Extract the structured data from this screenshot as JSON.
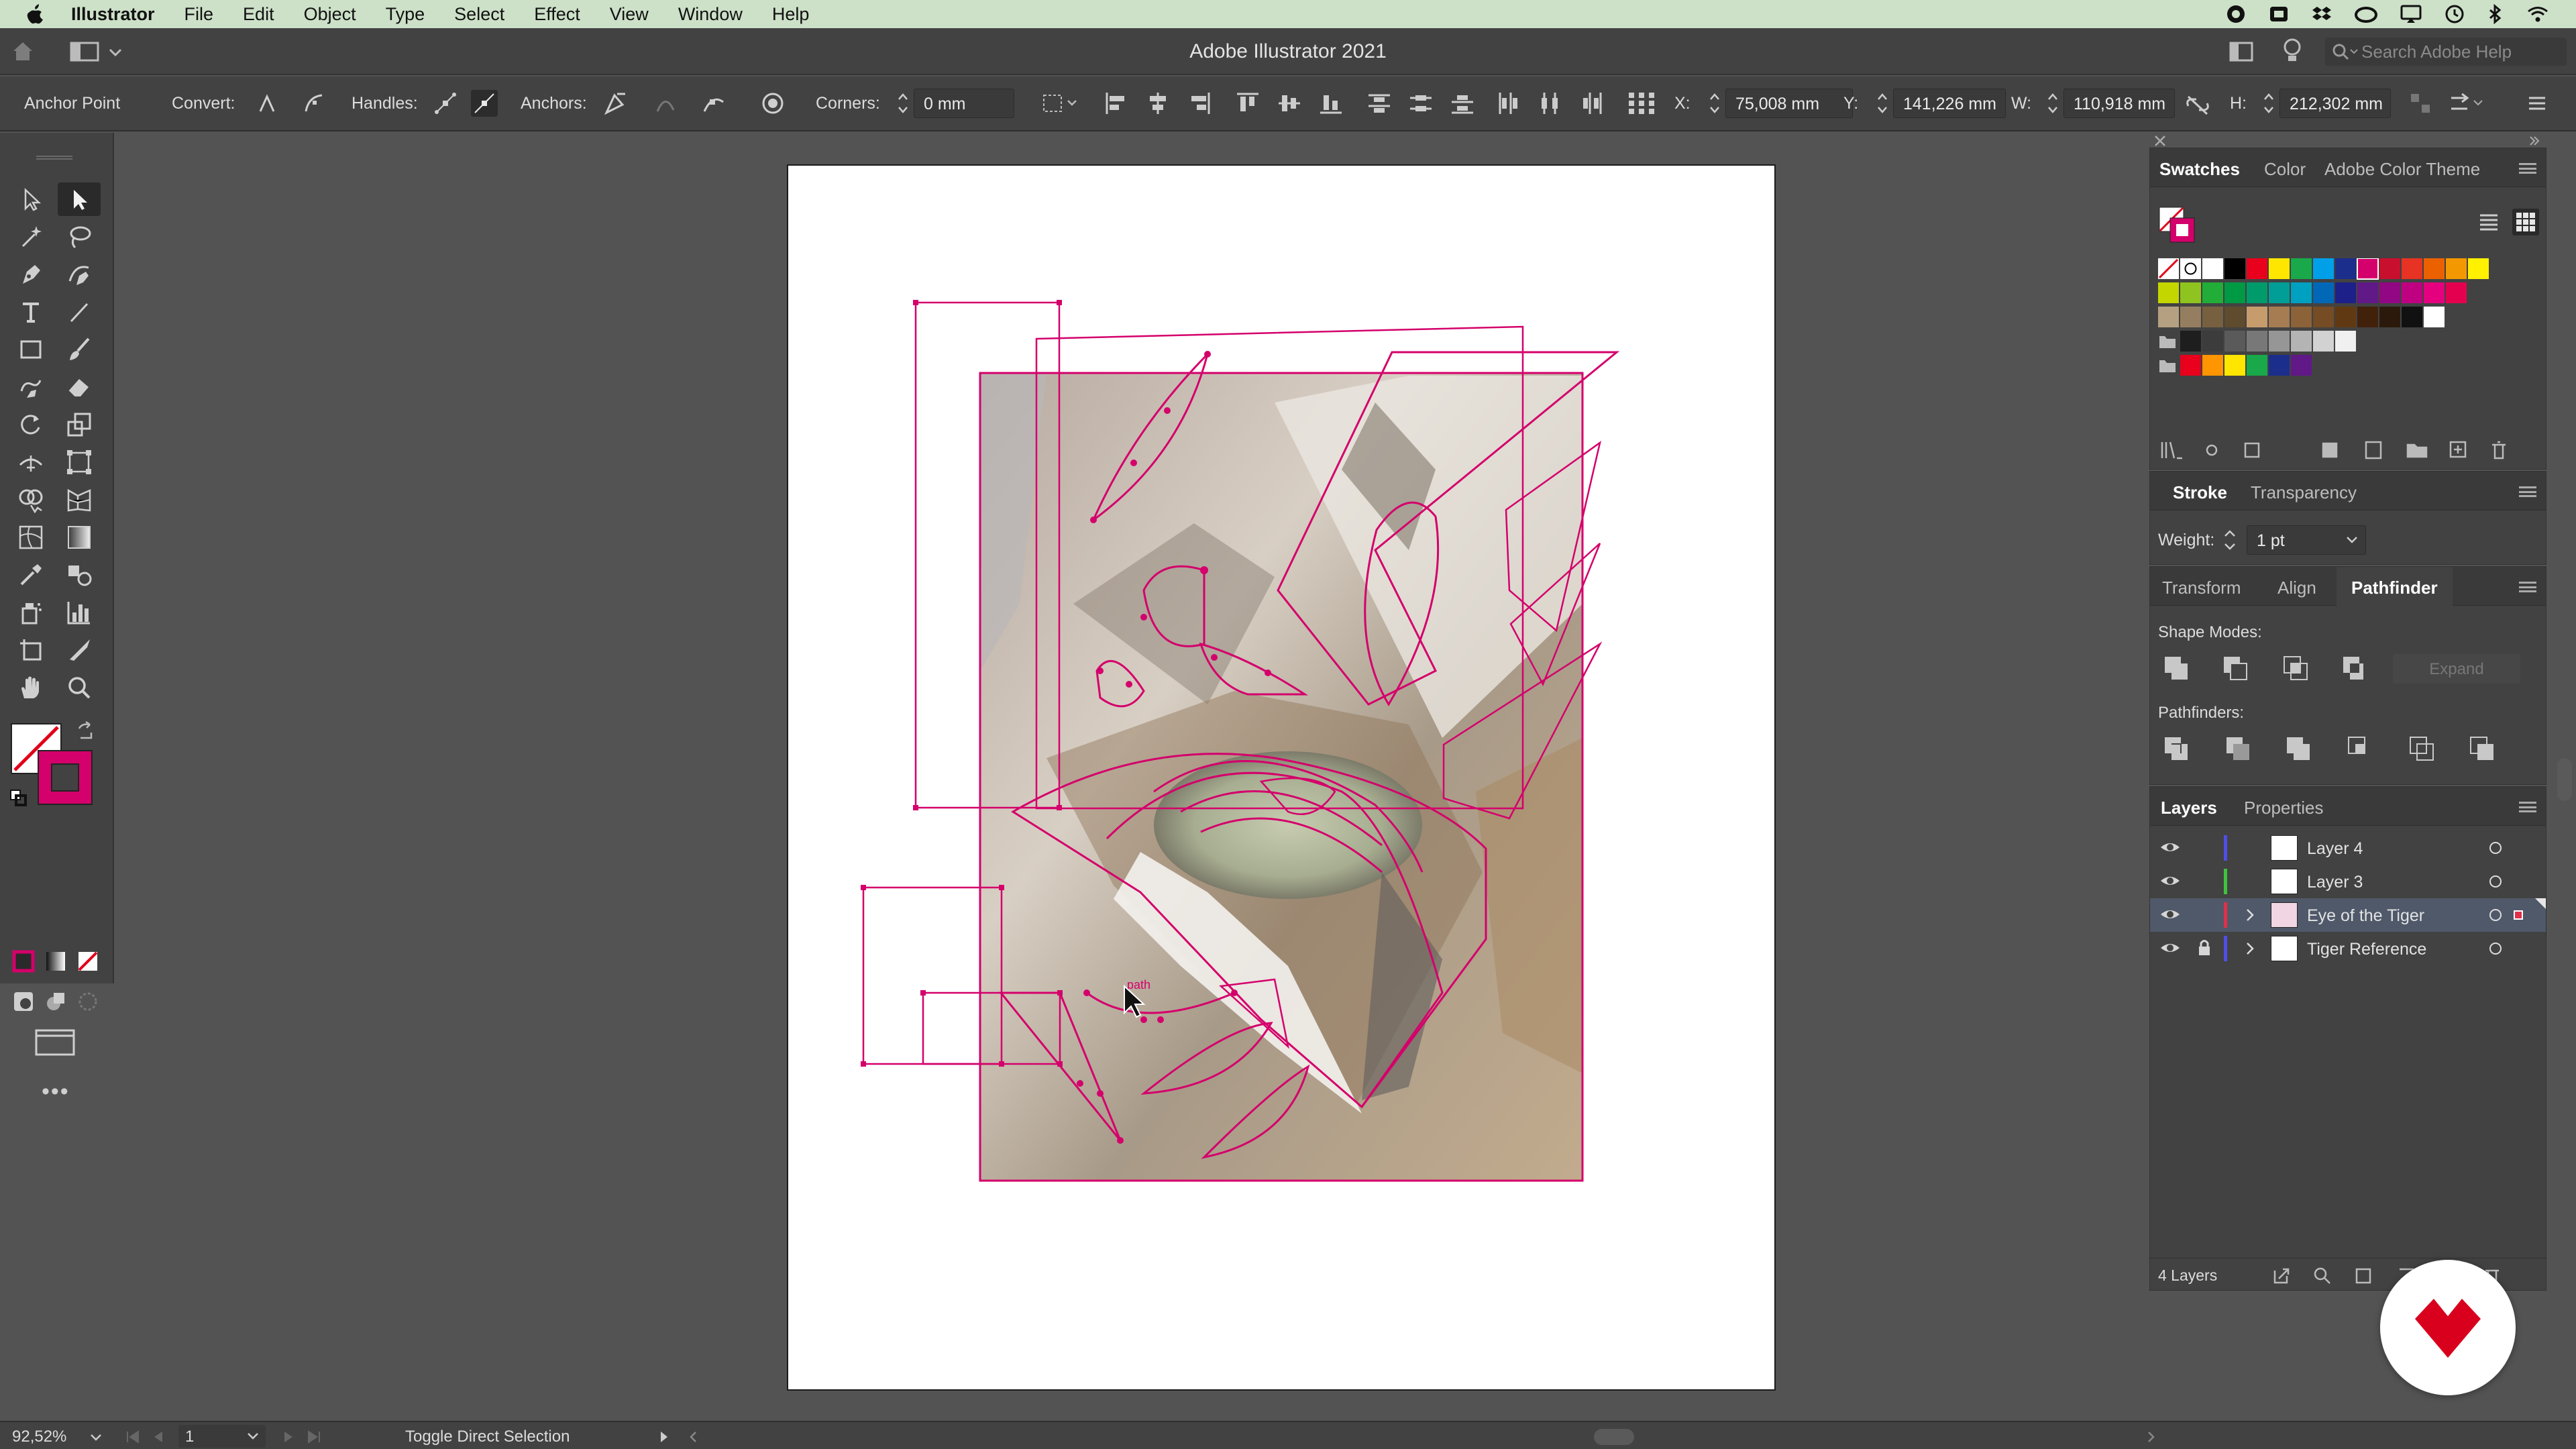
{
  "menubar": {
    "app_name": "Illustrator",
    "items": [
      "File",
      "Edit",
      "Object",
      "Type",
      "Select",
      "Effect",
      "View",
      "Window",
      "Help"
    ],
    "bg_color": "#cde0c8"
  },
  "appbar": {
    "title": "Adobe Illustrator 2021",
    "search_placeholder": "Search Adobe Help"
  },
  "controlbar": {
    "tool_label": "Anchor Point",
    "convert_label": "Convert:",
    "handles_label": "Handles:",
    "anchors_label": "Anchors:",
    "corners_label": "Corners:",
    "corners_value": "0 mm",
    "x_label": "X:",
    "x_value": "75,008 mm",
    "y_label": "Y:",
    "y_value": "141,226 mm",
    "w_label": "W:",
    "w_value": "110,918 mm",
    "h_label": "H:",
    "h_value": "212,302 mm"
  },
  "toolbar": {
    "fill_color": "none",
    "stroke_color": "#d4006b",
    "tools": [
      "selection-tool",
      "direct-selection-tool",
      "magic-wand-tool",
      "lasso-tool",
      "pen-tool",
      "curvature-tool",
      "type-tool",
      "line-segment-tool",
      "rectangle-tool",
      "paintbrush-tool",
      "shaper-tool",
      "eraser-tool",
      "rotate-tool",
      "scale-tool",
      "width-tool",
      "free-transform-tool",
      "shape-builder-tool",
      "perspective-grid-tool",
      "mesh-tool",
      "gradient-tool",
      "eyedropper-tool",
      "blend-tool",
      "symbol-sprayer-tool",
      "column-graph-tool",
      "artboard-tool",
      "slice-tool",
      "hand-tool",
      "zoom-tool"
    ]
  },
  "canvas": {
    "path_label": "path",
    "accent_color": "#d4006b"
  },
  "swatches_panel": {
    "tabs": [
      "Swatches",
      "Color",
      "Adobe Color Theme"
    ]
  },
  "stroke_panel": {
    "tabs": [
      "Stroke",
      "Transparency"
    ],
    "weight_label": "Weight:",
    "weight_value": "1 pt"
  },
  "pathfinder_panel": {
    "tabs": [
      "Transform",
      "Align",
      "Pathfinder"
    ],
    "shape_modes_label": "Shape Modes:",
    "expand_label": "Expand",
    "pathfinders_label": "Pathfinders:"
  },
  "layers_panel": {
    "tabs": [
      "Layers",
      "Properties"
    ],
    "layers": [
      {
        "name": "Layer 4",
        "color": "#4f4fe8",
        "selected": false,
        "locked": false,
        "expandable": false
      },
      {
        "name": "Layer 3",
        "color": "#3ec43e",
        "selected": false,
        "locked": false,
        "expandable": false
      },
      {
        "name": "Eye of the Tiger",
        "color": "#e0304a",
        "selected": true,
        "locked": false,
        "expandable": true
      },
      {
        "name": "Tiger Reference",
        "color": "#4f4fe8",
        "selected": false,
        "locked": true,
        "expandable": true
      }
    ],
    "count_label": "4 Layers"
  },
  "statusbar": {
    "zoom": "92,52%",
    "artboard_number": "1",
    "status_text": "Toggle Direct Selection"
  }
}
